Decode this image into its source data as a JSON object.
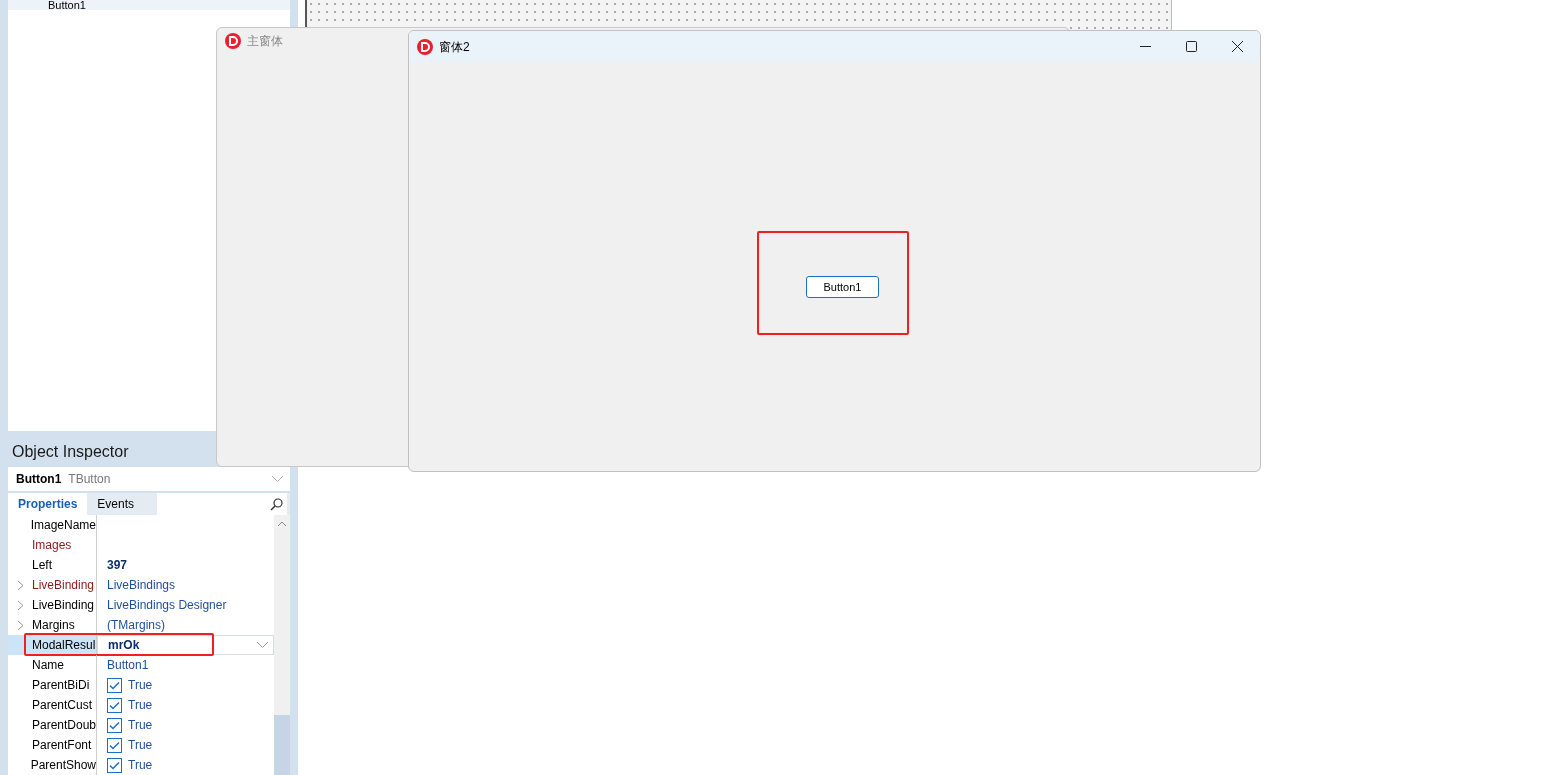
{
  "structure": {
    "items": [
      {
        "label": "Button1"
      }
    ]
  },
  "inspector": {
    "title": "Object Inspector",
    "component": {
      "name": "Button1",
      "type": "TButton"
    },
    "tabs": [
      {
        "label": "Properties",
        "selected": true
      },
      {
        "label": "Events",
        "selected": false
      }
    ],
    "properties": [
      {
        "name": "ImageName",
        "expandable": false,
        "reference": false,
        "selected": false,
        "kind": "text"
      },
      {
        "name": "Images",
        "expandable": false,
        "reference": true,
        "selected": false,
        "kind": "text"
      },
      {
        "name": "Left",
        "expandable": false,
        "reference": false,
        "selected": false,
        "kind": "bold",
        "value": "397"
      },
      {
        "name": "LiveBinding",
        "expandable": true,
        "reference": true,
        "selected": false,
        "kind": "text",
        "value": "LiveBindings"
      },
      {
        "name": "LiveBinding",
        "expandable": true,
        "reference": false,
        "selected": false,
        "kind": "text",
        "value": "LiveBindings Designer"
      },
      {
        "name": "Margins",
        "expandable": true,
        "reference": false,
        "selected": false,
        "kind": "text",
        "value": "(TMargins)"
      },
      {
        "name": "ModalResul",
        "expandable": false,
        "reference": false,
        "selected": true,
        "kind": "bold",
        "value": "mrOk"
      },
      {
        "name": "Name",
        "expandable": false,
        "reference": false,
        "selected": false,
        "kind": "text",
        "value": "Button1"
      },
      {
        "name": "ParentBiDi",
        "expandable": false,
        "reference": false,
        "selected": false,
        "kind": "checkbox",
        "checked": true,
        "value": "True"
      },
      {
        "name": "ParentCust",
        "expandable": false,
        "reference": false,
        "selected": false,
        "kind": "checkbox",
        "checked": true,
        "value": "True"
      },
      {
        "name": "ParentDoub",
        "expandable": false,
        "reference": false,
        "selected": false,
        "kind": "checkbox",
        "checked": true,
        "value": "True"
      },
      {
        "name": "ParentFont",
        "expandable": false,
        "reference": false,
        "selected": false,
        "kind": "checkbox",
        "checked": true,
        "value": "True"
      },
      {
        "name": "ParentShow",
        "expandable": false,
        "reference": false,
        "selected": false,
        "kind": "checkbox",
        "checked": true,
        "value": "True"
      }
    ]
  },
  "main_window": {
    "title": "主窗体",
    "active": false
  },
  "dialog": {
    "title": "窗体2",
    "button": "Button1"
  }
}
